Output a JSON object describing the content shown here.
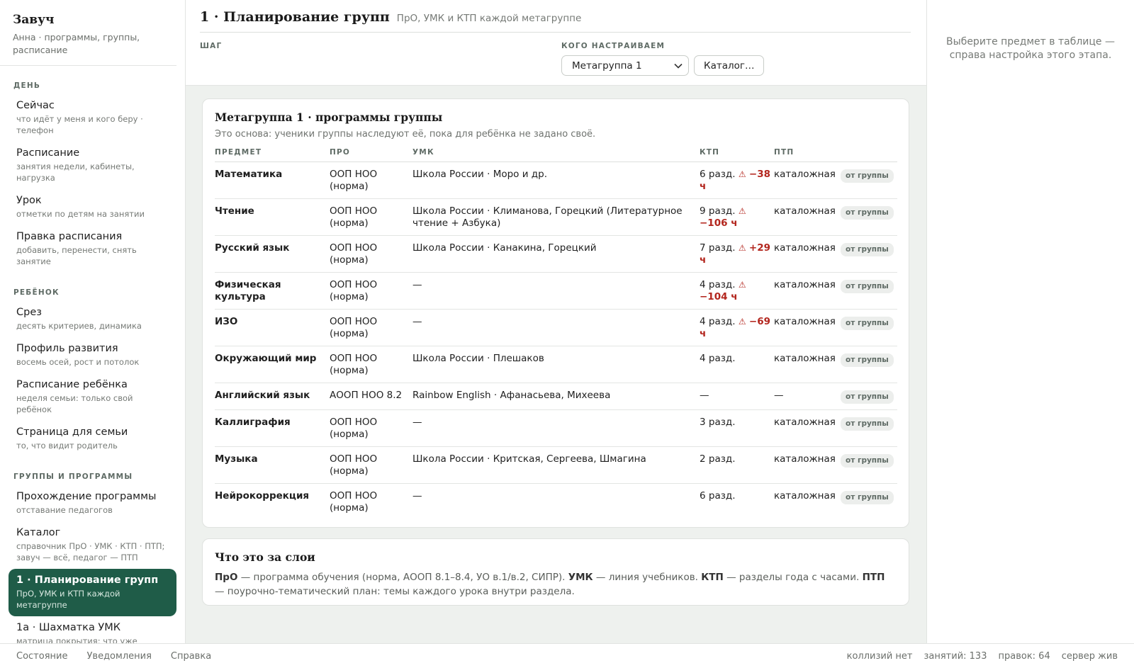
{
  "brand": {
    "title": "Завуч",
    "subtitle": "Анна · программы, группы, расписание"
  },
  "nav": {
    "sections": [
      {
        "title": "ДЕНЬ",
        "items": [
          {
            "label": "Сейчас",
            "sub": "что идёт у меня и кого беру · телефон"
          },
          {
            "label": "Расписание",
            "sub": "занятия недели, кабинеты, нагрузка"
          },
          {
            "label": "Урок",
            "sub": "отметки по детям на занятии"
          },
          {
            "label": "Правка расписания",
            "sub": "добавить, перенести, снять занятие"
          }
        ]
      },
      {
        "title": "РЕБЁНОК",
        "items": [
          {
            "label": "Срез",
            "sub": "десять критериев, динамика"
          },
          {
            "label": "Профиль развития",
            "sub": "восемь осей, рост и потолок"
          },
          {
            "label": "Расписание ребёнка",
            "sub": "неделя семьи: только свой ребёнок"
          },
          {
            "label": "Страница для семьи",
            "sub": "то, что видит родитель"
          }
        ]
      },
      {
        "title": "ГРУППЫ И ПРОГРАММЫ",
        "items": [
          {
            "label": "Прохождение программы",
            "sub": "отставание педагогов"
          },
          {
            "label": "Каталог",
            "sub": "справочник ПрО · УМК · КТП · ПТП; завуч — всё, педагог — ПТП"
          },
          {
            "label": "1 · Планирование групп",
            "sub": "ПрО, УМК и КТП каждой метагруппе",
            "active": true
          },
          {
            "label": "1а · Шахматка УМК",
            "sub": "матрица покрытия: что уже задано"
          }
        ]
      }
    ]
  },
  "header": {
    "title": "1 · Планирование групп",
    "subtitle": "ПрО, УМК и КТП каждой метагруппе",
    "step_label": "ШАГ",
    "who_label": "КОГО НАСТРАИВАЕМ",
    "select_value": "Метагруппа 1",
    "catalog_button": "Каталог…"
  },
  "programs": {
    "title": "Метагруппа 1 · программы группы",
    "subtitle": "Это основа: ученики группы наследуют её, пока для ребёнка не задано своё.",
    "columns": [
      "ПРЕДМЕТ",
      "ПРО",
      "УМК",
      "КТП",
      "ПТП"
    ],
    "rows": [
      {
        "subject": "Математика",
        "pro": "ООП НОО (норма)",
        "umk": "Школа России · Моро и др.",
        "ktp": "6 разд.",
        "warn": "−38 ч",
        "ptp": "каталожная",
        "badge": "от группы"
      },
      {
        "subject": "Чтение",
        "pro": "ООП НОО (норма)",
        "umk": "Школа России · Климанова, Горецкий (Литературное чтение + Азбука)",
        "ktp": "9 разд.",
        "warn": "−106 ч",
        "ptp": "каталожная",
        "badge": "от группы"
      },
      {
        "subject": "Русский язык",
        "pro": "ООП НОО (норма)",
        "umk": "Школа России · Канакина, Горецкий",
        "ktp": "7 разд.",
        "warn": "+29 ч",
        "ptp": "каталожная",
        "badge": "от группы"
      },
      {
        "subject": "Физическая культура",
        "pro": "ООП НОО (норма)",
        "umk": "—",
        "ktp": "4 разд.",
        "warn": "−104 ч",
        "ptp": "каталожная",
        "badge": "от группы"
      },
      {
        "subject": "ИЗО",
        "pro": "ООП НОО (норма)",
        "umk": "—",
        "ktp": "4 разд.",
        "warn": "−69 ч",
        "ptp": "каталожная",
        "badge": "от группы"
      },
      {
        "subject": "Окружающий мир",
        "pro": "ООП НОО (норма)",
        "umk": "Школа России · Плешаков",
        "ktp": "4 разд.",
        "warn": "",
        "ptp": "каталожная",
        "badge": "от группы"
      },
      {
        "subject": "Английский язык",
        "pro": "АООП НОО 8.2",
        "umk": "Rainbow English · Афанасьева, Михеева",
        "ktp": "—",
        "warn": "",
        "ptp": "—",
        "badge": "от группы"
      },
      {
        "subject": "Каллиграфия",
        "pro": "ООП НОО (норма)",
        "umk": "—",
        "ktp": "3 разд.",
        "warn": "",
        "ptp": "каталожная",
        "badge": "от группы"
      },
      {
        "subject": "Музыка",
        "pro": "ООП НОО (норма)",
        "umk": "Школа России · Критская, Сергеева, Шмагина",
        "ktp": "2 разд.",
        "warn": "",
        "ptp": "каталожная",
        "badge": "от группы"
      },
      {
        "subject": "Нейрокоррекция",
        "pro": "ООП НОО (норма)",
        "umk": "—",
        "ktp": "6 разд.",
        "warn": "",
        "ptp": "каталожная",
        "badge": "от группы"
      }
    ]
  },
  "layers": {
    "title": "Что это за слои",
    "parts": [
      {
        "b": "ПрО",
        "t": " — программа обучения (норма, АООП 8.1–8.4, УО в.1/в.2, СИПР). "
      },
      {
        "b": "УМК",
        "t": " — линия учебников. "
      },
      {
        "b": "КТП",
        "t": " — разделы года с часами. "
      },
      {
        "b": "ПТП",
        "t": " — поурочно-тематический план: темы каждого урока внутри раздела."
      }
    ]
  },
  "right_panel": {
    "hint": "Выберите предмет в таблице — справа настройка этого этапа."
  },
  "footer": {
    "links": [
      "Состояние",
      "Уведомления",
      "Справка"
    ],
    "status": [
      "коллизий нет",
      "занятий: 133",
      "правок: 64",
      "сервер жив"
    ]
  },
  "colors": {
    "accent": "#1f5c48",
    "warning": "#b3261e"
  }
}
